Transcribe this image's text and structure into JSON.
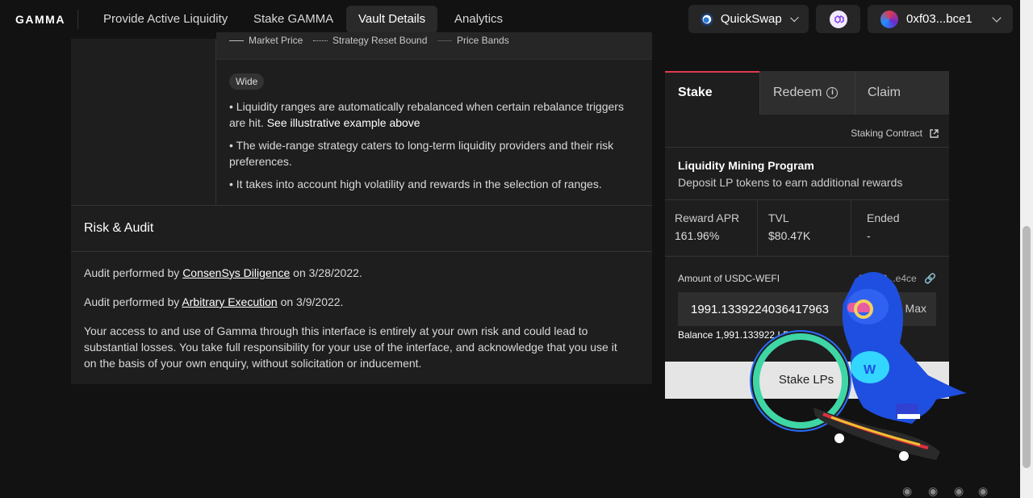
{
  "nav": {
    "logo": "GAMMA",
    "links": [
      "Provide Active Liquidity",
      "Stake GAMMA",
      "Vault Details",
      "Analytics"
    ],
    "network": "QuickSwap",
    "wallet": "0xf03...bce1"
  },
  "strategy": {
    "legend": [
      "Market Price",
      "Strategy Reset Bound",
      "Price Bands"
    ],
    "badge": "Wide",
    "bullet1": "• Liquidity ranges are automatically rebalanced when certain rebalance triggers are hit.",
    "bullet1_link": "See illustrative example above",
    "bullet2": "• The wide-range strategy caters to long-term liquidity providers and their risk preferences.",
    "bullet3": "• It takes into account high volatility and rewards in the selection of ranges."
  },
  "risk": {
    "title": "Risk & Audit",
    "audit1_prefix": "Audit performed by",
    "audit1_firm": "ConsenSys Diligence",
    "audit1_date": "on 3/28/2022.",
    "audit2_prefix": "Audit performed by",
    "audit2_firm": "Arbitrary Execution",
    "audit2_date": "on 3/9/2022.",
    "disclaimer": "Your access to and use of Gamma through this interface is entirely at your own risk and could lead to substantial losses. You take full responsibility for your use of the interface, and acknowledge that you use it on the basis of your own enquiry, without solicitation or inducement."
  },
  "stake_panel": {
    "tabs": [
      "Stake",
      "Redeem",
      "Claim"
    ],
    "contract_link": "Staking Contract",
    "program_title": "Liquidity Mining Program",
    "program_sub": "Deposit LP tokens to earn additional rewards",
    "stats": [
      {
        "label": "Reward APR",
        "value": "161.96%"
      },
      {
        "label": "TVL",
        "value": "$80.47K"
      },
      {
        "label": "Ended",
        "value": "-"
      }
    ],
    "amount_label": "Amount of USDC-WEFI",
    "address": "0x...49...e4ce",
    "amount_value": "1991.1339224036417963",
    "max": "Max",
    "balance": "Balance 1,991.133922 LP",
    "button": "Stake LPs"
  }
}
